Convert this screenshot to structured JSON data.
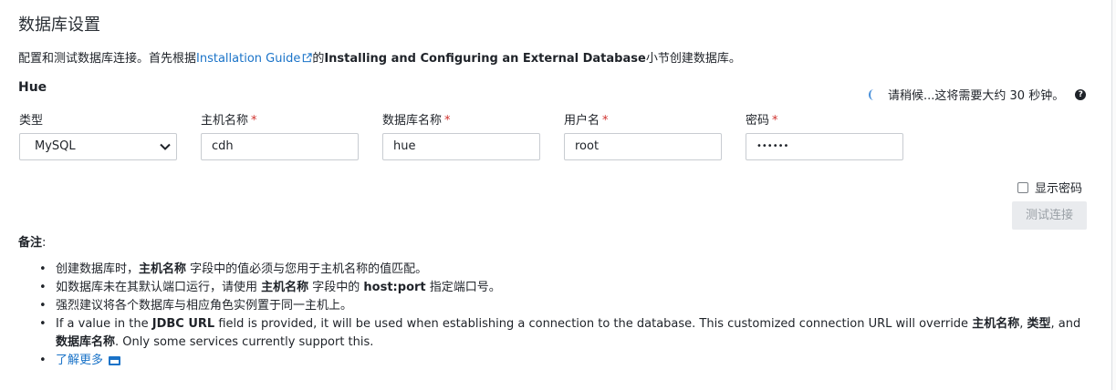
{
  "page": {
    "title": "数据库设置",
    "intro_prefix": "配置和测试数据库连接。首先根据",
    "intro_link": "Installation Guide",
    "intro_mid": "的",
    "intro_bold": "Installing and Configuring an External Database",
    "intro_suffix": "小节创建数据库。"
  },
  "service": {
    "name": "Hue",
    "status_text": "请稍候...这将需要大约 30 秒钟。",
    "help_icon": "question-circle-icon"
  },
  "fields": {
    "type": {
      "label": "类型",
      "value": "MySQL"
    },
    "host": {
      "label": "主机名称",
      "required": "*",
      "value": "cdh"
    },
    "dbname": {
      "label": "数据库名称",
      "required": "*",
      "value": "hue"
    },
    "user": {
      "label": "用户名",
      "required": "*",
      "value": "root"
    },
    "password": {
      "label": "密码",
      "required": "*",
      "value": "••••••"
    }
  },
  "actions": {
    "show_password": "显示密码",
    "test_connection": "测试连接"
  },
  "notes": {
    "title": "备注",
    "colon": ":",
    "n1": {
      "a": "创建数据库时，",
      "b": "主机名称",
      "c": " 字段中的值必须与您用于主机名称的值匹配。"
    },
    "n2": {
      "a": "如数据库未在其默认端口运行，请使用 ",
      "b": "主机名称",
      "c": " 字段中的 ",
      "d": "host:port",
      "e": " 指定端口号。"
    },
    "n3": {
      "a": "强烈建议将各个数据库与相应角色实例置于同一主机上。"
    },
    "n4": {
      "a": "If a value in the ",
      "b": "JDBC URL",
      "c": " field is provided, it will be used when establishing a connection to the database. This customized connection URL will override ",
      "d": "主机名称",
      "e": ", ",
      "f": "类型",
      "g": ", and ",
      "h": "数据库名称",
      "i": ". Only some services currently support this."
    },
    "learn_more": "了解更多"
  },
  "colors": {
    "link": "#1a73c8",
    "required": "#d0312d",
    "disabled_bg": "#e9ebee"
  }
}
